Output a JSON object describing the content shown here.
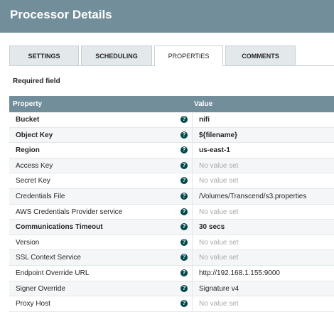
{
  "header": {
    "title": "Processor Details"
  },
  "tabs": [
    {
      "label": "SETTINGS"
    },
    {
      "label": "SCHEDULING"
    },
    {
      "label": "PROPERTIES"
    },
    {
      "label": "COMMENTS"
    }
  ],
  "active_tab": "PROPERTIES",
  "required_label": "Required field",
  "table": {
    "headers": {
      "property": "Property",
      "value": "Value"
    },
    "rows": [
      {
        "name": "Bucket",
        "value": "nifi",
        "required": true,
        "set": true
      },
      {
        "name": "Object Key",
        "value": "${filename}",
        "required": true,
        "set": true
      },
      {
        "name": "Region",
        "value": "us-east-1",
        "required": true,
        "set": true
      },
      {
        "name": "Access Key",
        "value": "No value set",
        "required": false,
        "set": false
      },
      {
        "name": "Secret Key",
        "value": "No value set",
        "required": false,
        "set": false
      },
      {
        "name": "Credentials File",
        "value": "/Volumes/Transcend/s3.properties",
        "required": false,
        "set": true
      },
      {
        "name": "AWS Credentials Provider service",
        "value": "No value set",
        "required": false,
        "set": false
      },
      {
        "name": "Communications Timeout",
        "value": "30 secs",
        "required": true,
        "set": true
      },
      {
        "name": "Version",
        "value": "No value set",
        "required": false,
        "set": false
      },
      {
        "name": "SSL Context Service",
        "value": "No value set",
        "required": false,
        "set": false
      },
      {
        "name": "Endpoint Override URL",
        "value": "http://192.168.1.155:9000",
        "required": false,
        "set": true
      },
      {
        "name": "Signer Override",
        "value": "Signature v4",
        "required": false,
        "set": true
      },
      {
        "name": "Proxy Host",
        "value": "No value set",
        "required": false,
        "set": false
      }
    ]
  },
  "icons": {
    "help": "help-icon"
  },
  "colors": {
    "header": "#728e9b",
    "help_icon": "#004849",
    "unset_text": "#aaaaaa"
  }
}
